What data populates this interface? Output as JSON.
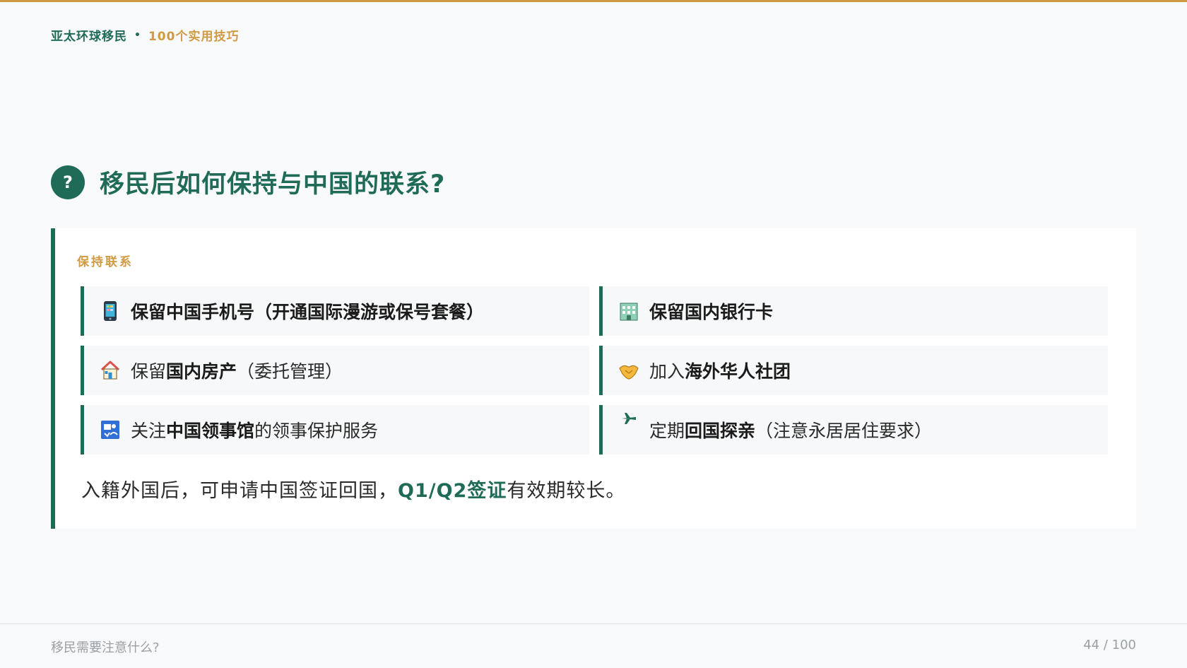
{
  "brand": {
    "name": "亚太环球移民",
    "separator": "•",
    "series": "100个实用技巧"
  },
  "question": {
    "badge": "?",
    "title": "移民后如何保持与中国的联系?"
  },
  "card": {
    "label": "保持联系",
    "items": [
      {
        "icon": "mobile-phone-icon",
        "text": "保留中国手机号（开通国际漫游或保号套餐）"
      },
      {
        "icon": "office-building-icon",
        "text": "保留国内银行卡"
      },
      {
        "icon": "house-icon",
        "pre": "保留",
        "strong": "国内房产",
        "post": "（委托管理）"
      },
      {
        "icon": "handshake-icon",
        "pre": "加入",
        "strong": "海外华人社团",
        "post": ""
      },
      {
        "icon": "passport-control-icon",
        "pre": "关注",
        "strong": "中国领事馆",
        "post": "的领事保护服务"
      },
      {
        "icon": "airplane-icon",
        "pre": "定期",
        "strong": "回国探亲",
        "post": "（注意永居居住要求）"
      }
    ],
    "note": {
      "pre": "入籍外国后，可申请中国签证回国，",
      "highlight": "Q1/Q2签证",
      "post": "有效期较长。"
    }
  },
  "footer": {
    "section": "移民需要注意什么?",
    "page": "44 / 100"
  },
  "colors": {
    "primary": "#1f6b58",
    "accent": "#d09a42"
  }
}
